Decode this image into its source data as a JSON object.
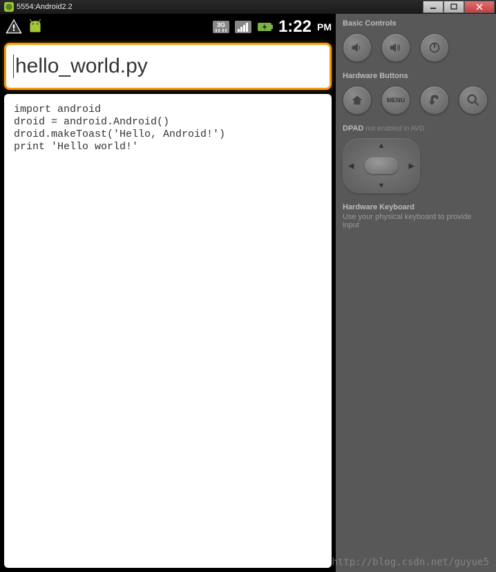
{
  "window": {
    "title": "5554:Android2.2"
  },
  "statusbar": {
    "time": "1:22",
    "ampm": "PM",
    "network_label": "3G"
  },
  "editor": {
    "filename": "hello_world.py",
    "code": "import android\ndroid = android.Android()\ndroid.makeToast('Hello, Android!')\nprint 'Hello world!'"
  },
  "controls": {
    "basic_title": "Basic Controls",
    "hardware_title": "Hardware Buttons",
    "menu_label": "MENU",
    "dpad_title": "DPAD",
    "dpad_subtitle": "not enabled in AVD",
    "keyboard_title": "Hardware Keyboard",
    "keyboard_subtitle": "Use your physical keyboard to provide input"
  },
  "watermark": "http://blog.csdn.net/guyue5"
}
